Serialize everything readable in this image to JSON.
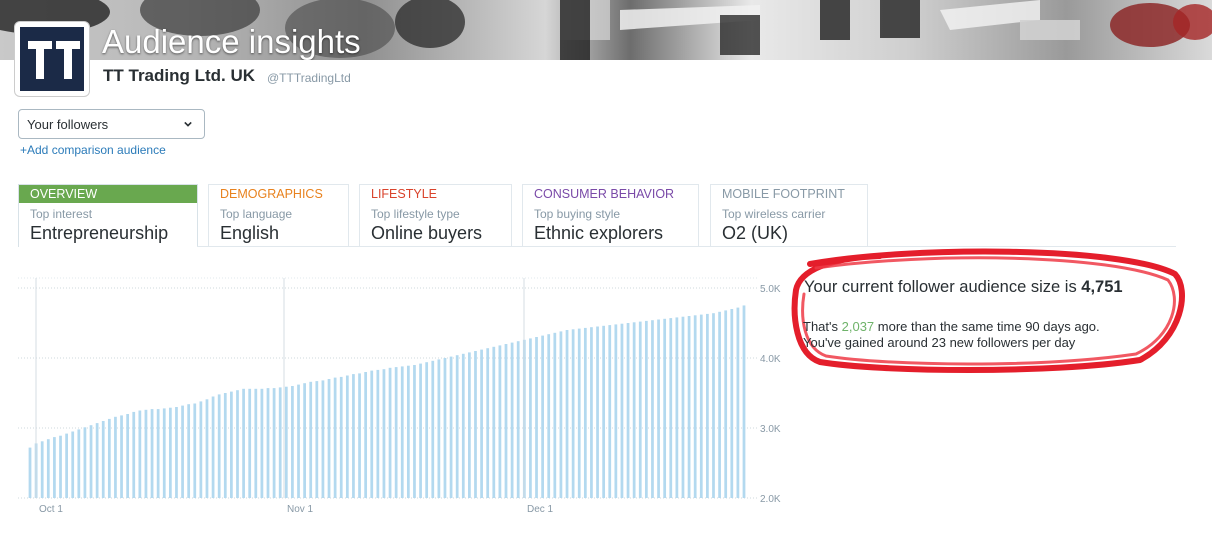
{
  "header": {
    "title": "Audience insights",
    "account_name": "TT Trading Ltd. UK",
    "handle": "@TTTradingLtd"
  },
  "audience": {
    "selected": "Your followers",
    "add_comparison": "+Add comparison audience"
  },
  "tabs": [
    {
      "name": "OVERVIEW",
      "sub": "Top interest",
      "value": "Entrepreneurship",
      "color": "#ffffff",
      "bg": "#69a84f"
    },
    {
      "name": "DEMOGRAPHICS",
      "sub": "Top language",
      "value": "English",
      "color": "#e8821e"
    },
    {
      "name": "LIFESTYLE",
      "sub": "Top lifestyle type",
      "value": "Online buyers",
      "color": "#d9432c"
    },
    {
      "name": "CONSUMER BEHAVIOR",
      "sub": "Top buying style",
      "value": "Ethnic explorers",
      "color": "#7a4aa8"
    },
    {
      "name": "MOBILE FOOTPRINT",
      "sub": "Top wireless carrier",
      "value": "O2 (UK)",
      "color": "#8899a6"
    }
  ],
  "stats": {
    "prefix": "Your current follower audience size is",
    "size": "4,751",
    "line2_prefix": "That's",
    "gained": "2,037",
    "line2_suffix": "more than the same time 90 days ago.",
    "line3": "You've gained around 23 new followers per day"
  },
  "chart_data": {
    "type": "bar",
    "x_ticks": [
      "Oct 1",
      "Nov 1",
      "Dec 1"
    ],
    "y_ticks": [
      "5.0K",
      "4.0K",
      "3.0K",
      "2.0K"
    ],
    "ylim": [
      2000,
      5000
    ],
    "bar_color": "#b3d9ef",
    "values": [
      2720,
      2780,
      2810,
      2840,
      2870,
      2890,
      2920,
      2950,
      2980,
      3010,
      3040,
      3070,
      3100,
      3130,
      3160,
      3180,
      3200,
      3230,
      3250,
      3260,
      3270,
      3270,
      3280,
      3290,
      3300,
      3320,
      3340,
      3350,
      3380,
      3410,
      3450,
      3480,
      3500,
      3520,
      3540,
      3560,
      3560,
      3560,
      3560,
      3570,
      3570,
      3580,
      3590,
      3600,
      3620,
      3640,
      3660,
      3670,
      3680,
      3700,
      3720,
      3730,
      3750,
      3770,
      3780,
      3800,
      3820,
      3830,
      3840,
      3860,
      3870,
      3880,
      3890,
      3900,
      3920,
      3940,
      3960,
      3980,
      4000,
      4020,
      4040,
      4060,
      4080,
      4100,
      4120,
      4140,
      4160,
      4180,
      4200,
      4220,
      4240,
      4260,
      4280,
      4300,
      4320,
      4340,
      4360,
      4380,
      4400,
      4410,
      4420,
      4430,
      4440,
      4450,
      4460,
      4470,
      4480,
      4490,
      4500,
      4510,
      4520,
      4530,
      4540,
      4550,
      4560,
      4570,
      4580,
      4590,
      4600,
      4610,
      4620,
      4630,
      4640,
      4660,
      4680,
      4700,
      4720,
      4751
    ]
  },
  "colors": {
    "accent": "#2b7bb9",
    "highlight_ring": "#e41e2b"
  }
}
